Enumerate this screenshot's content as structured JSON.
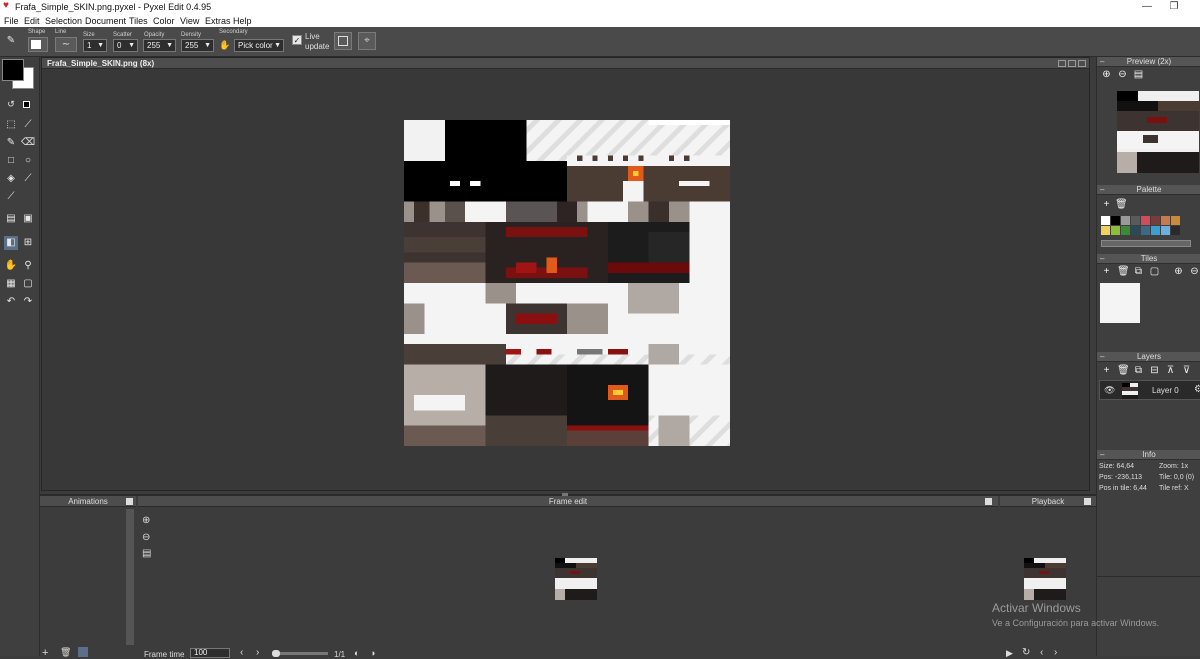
{
  "window": {
    "title": "Frafa_Simple_SKIN.png.pyxel - Pyxel Edit 0.4.95",
    "minimize_glyph": "—",
    "restore_glyph": "❐"
  },
  "menu": [
    "File",
    "Edit",
    "Selection",
    "Document",
    "Tiles",
    "Color",
    "View",
    "Extras",
    "Help"
  ],
  "toolbar": {
    "shape_label": "Shape",
    "line_label": "Line",
    "size_label": "Size",
    "size_value": "1",
    "scatter_label": "Scatter",
    "scatter_value": "0",
    "opacity_label": "Opacity",
    "opacity_value": "255",
    "density_label": "Density",
    "density_value": "255",
    "secondary_label": "Secondary",
    "secondary_value": "Pick color",
    "live_update_label_1": "Live",
    "live_update_label_2": "update",
    "live_update_checked": true
  },
  "canvas": {
    "doc_title": "Frafa_Simple_SKIN.png  (8x)",
    "zoom": "8x"
  },
  "panels": {
    "preview_title": "Preview (2x)",
    "palette_title": "Palette",
    "tiles_title": "Tiles",
    "layers_title": "Layers",
    "layer_name": "Layer 0",
    "info_title": "Info",
    "info": {
      "size": "Size: 64,64",
      "zoom": "Zoom: 1x",
      "pos": "Pos: -236,113",
      "tile": "Tile: 0,0 (0)",
      "pos_in_tile": "Pos in tile: 6,44",
      "tile_ref": "Tile ref: X"
    }
  },
  "palette_colors": [
    "#ffffff",
    "#000000",
    "#9a9a9a",
    "#5a5a5a",
    "#d24b5a",
    "#7a3b3b",
    "#c77a4a",
    "#c98a3a",
    "#f0d060",
    "#8bbf3a",
    "#3a8a3a",
    "#2a4a5a",
    "#3a6a8a",
    "#3aa0d0",
    "#6ab0e0",
    "#2a2a2a"
  ],
  "bottom": {
    "animations_title": "Animations",
    "frame_edit_title": "Frame edit",
    "playback_title": "Playback",
    "frame_time_label": "Frame time",
    "frame_time_value": "100",
    "frame_counter": "1/1"
  },
  "watermark": {
    "line1": "Activar Windows",
    "line2": "Ve a Configuración para activar Windows."
  },
  "colors": {
    "primary": "#000000",
    "secondary": "#ffffff",
    "heart": "#d61f2c"
  }
}
